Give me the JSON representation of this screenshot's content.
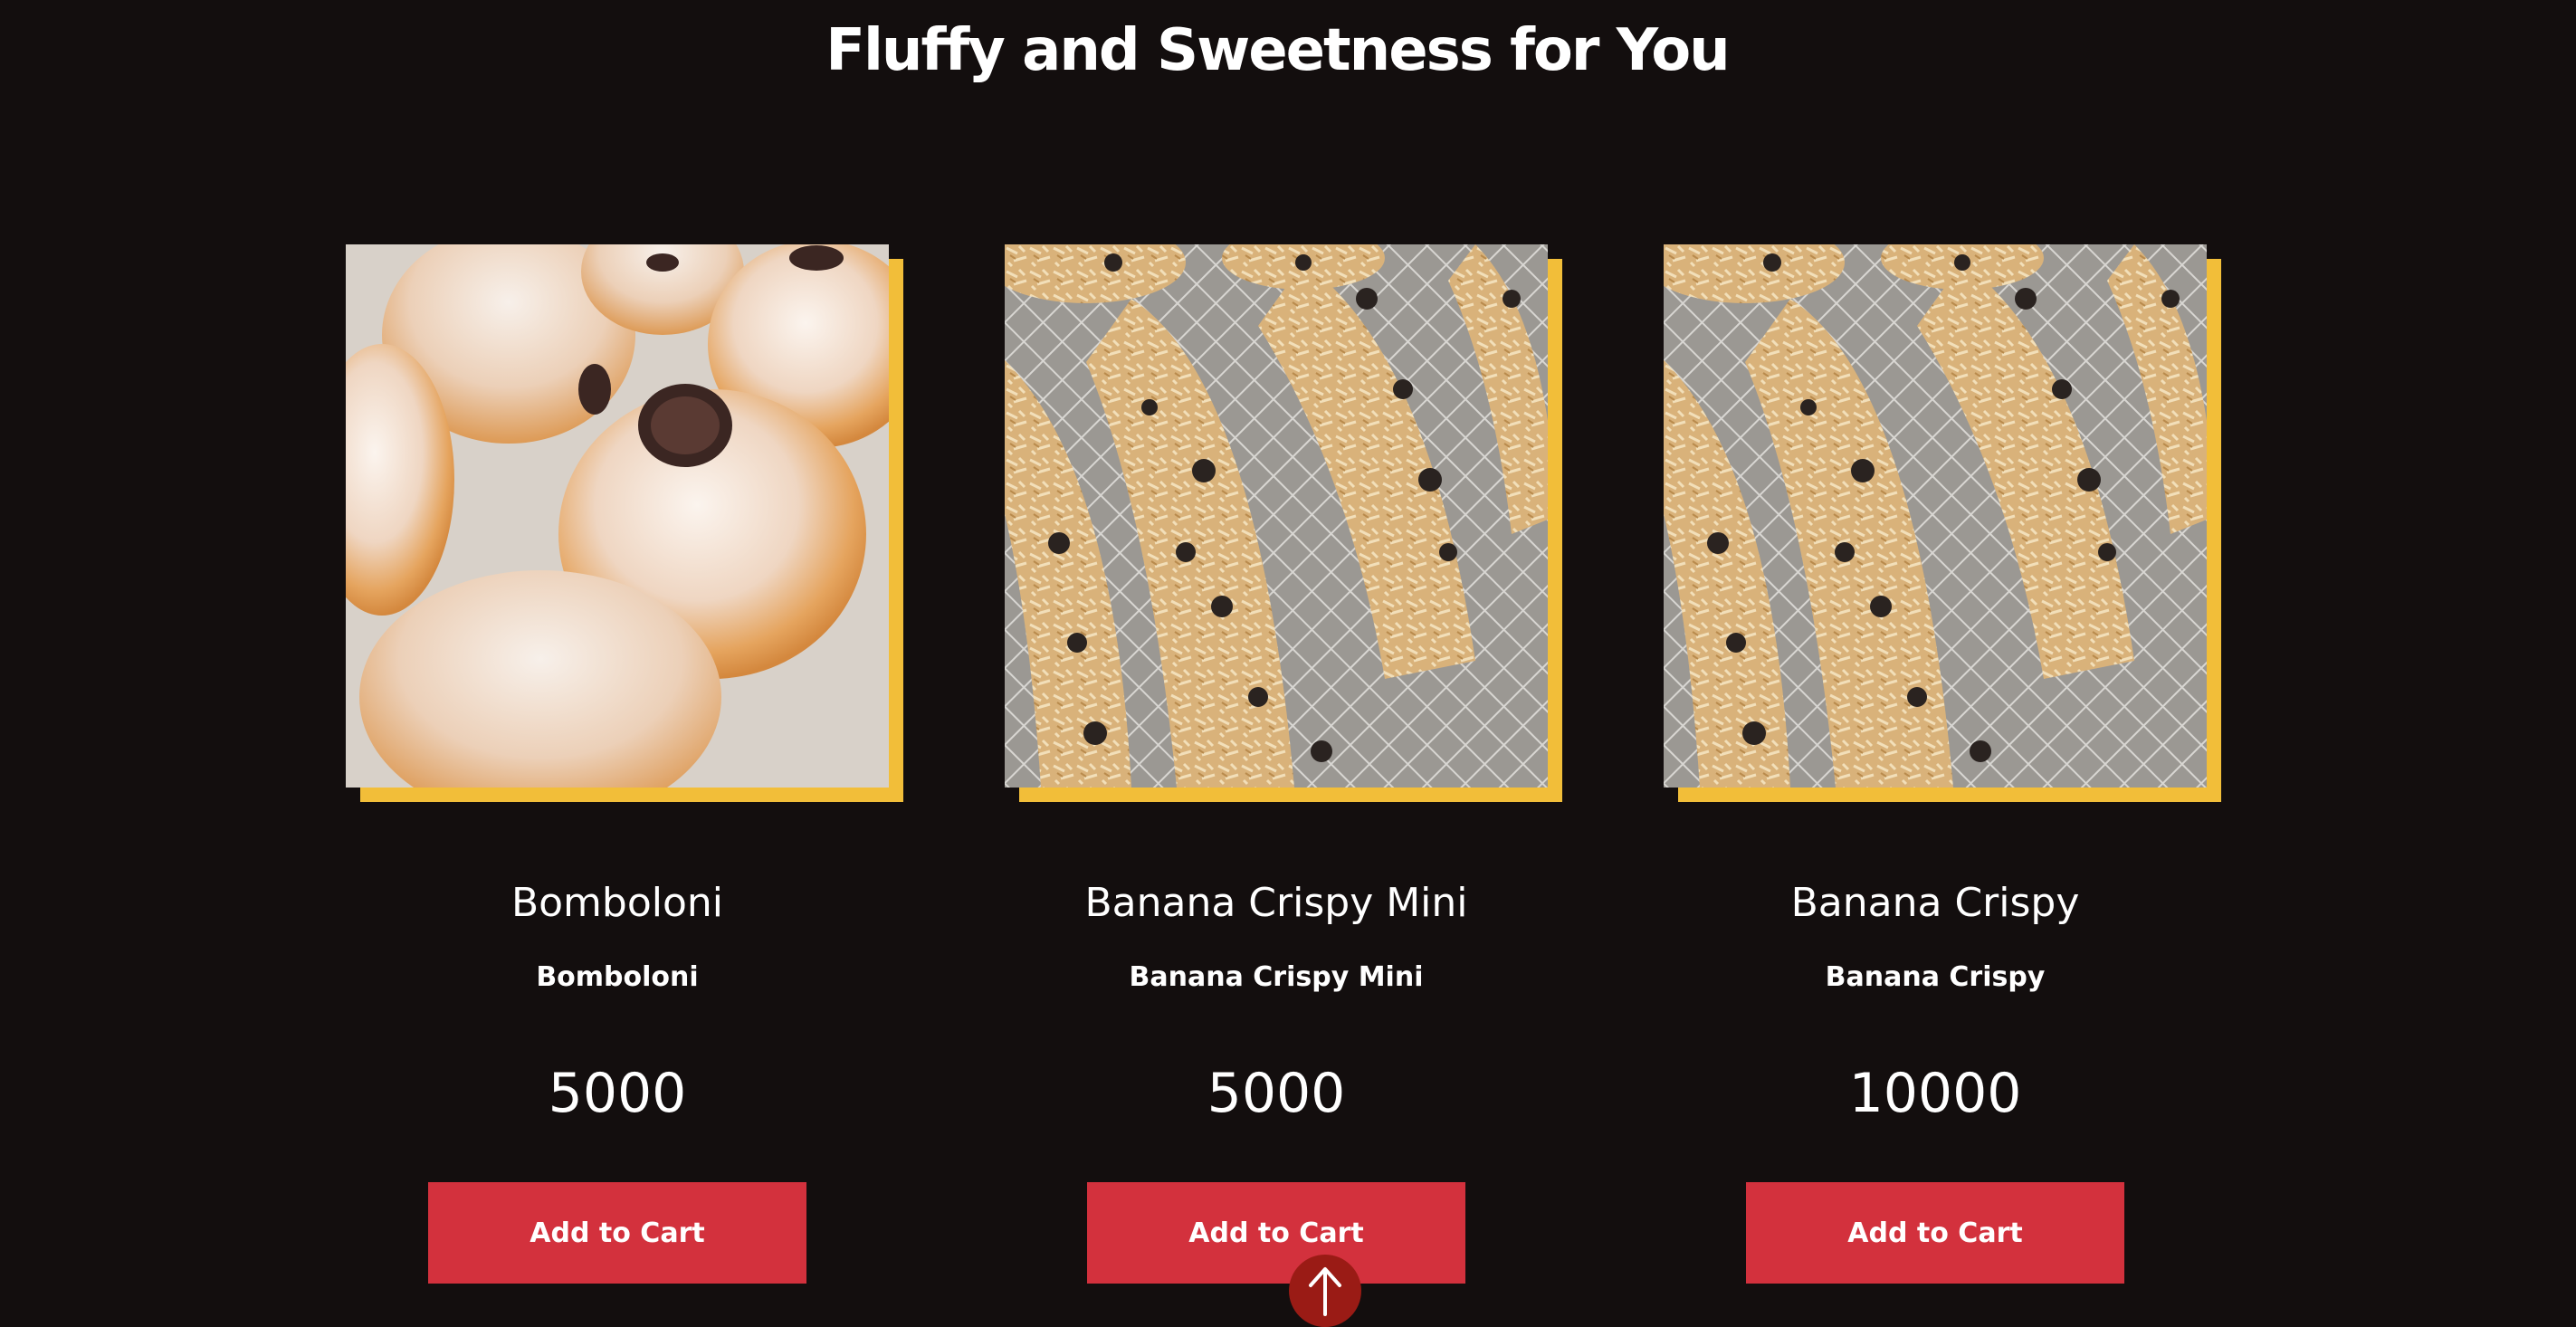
{
  "page": {
    "title": "Fluffy and Sweetness for You"
  },
  "products": [
    {
      "name": "Bomboloni",
      "description": "Bomboloni",
      "price": "5000",
      "button_label": "Add to Cart"
    },
    {
      "name": "Banana Crispy Mini",
      "description": "Banana Crispy Mini",
      "price": "5000",
      "button_label": "Add to Cart"
    },
    {
      "name": "Banana Crispy",
      "description": "Banana Crispy",
      "price": "10000",
      "button_label": "Add to Cart"
    }
  ],
  "back_to_top": {
    "icon": "arrow-up-icon"
  },
  "colors": {
    "background": "#130e0e",
    "accent_frame": "#f2be39",
    "button": "#d3313d",
    "back_to_top": "#9a1b15"
  }
}
